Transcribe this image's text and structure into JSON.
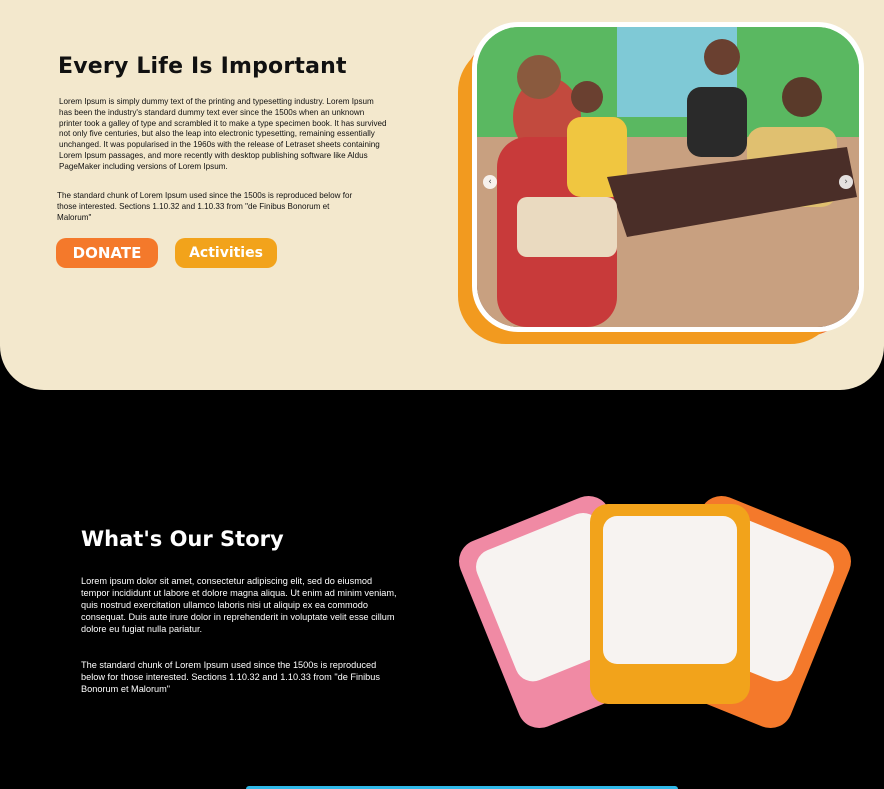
{
  "hero": {
    "title": "Every Life Is Important",
    "paragraph1": "Lorem Ipsum is simply dummy text of the printing and typesetting industry. Lorem Ipsum has been the industry's standard dummy text ever since the 1500s when an unknown printer took a galley of type and scrambled it to make a type specimen book. It has survived not only five centuries, but also the leap into electronic typesetting, remaining essentially unchanged. It was popularised in the 1960s with the release of Letraset sheets containing Lorem Ipsum passages, and more recently with desktop publishing software like Aldus PageMaker including versions of Lorem Ipsum.",
    "paragraph2": "The standard chunk of Lorem Ipsum used since the 1500s is reproduced below for those interested. Sections 1.10.32 and 1.10.33 from \"de Finibus Bonorum et Malorum\"",
    "donate_label": "DONATE",
    "activities_label": "Activities",
    "carousel": {
      "prev_icon": "‹",
      "next_icon": "›"
    }
  },
  "story": {
    "title": "What's Our Story",
    "paragraph1": "Lorem ipsum dolor sit amet, consectetur adipiscing elit, sed do eiusmod tempor incididunt ut labore et dolore magna aliqua. Ut enim ad minim veniam, quis nostrud exercitation ullamco laboris nisi ut aliquip ex ea commodo consequat. Duis aute irure dolor in reprehenderit in voluptate velit esse cillum dolore eu fugiat nulla pariatur.",
    "paragraph2": "The standard chunk of Lorem Ipsum used since the 1500s is reproduced below for those interested. Sections 1.10.32 and 1.10.33 from \"de Finibus Bonorum et Malorum\""
  },
  "colors": {
    "hero_bg": "#f3e8cd",
    "donate": "#f4792b",
    "activities": "#f2a31b",
    "card_pink": "#f08aa4",
    "card_orange": "#f4792b",
    "card_yellow": "#f2a31b",
    "accent_bar": "#2fb8e8"
  }
}
